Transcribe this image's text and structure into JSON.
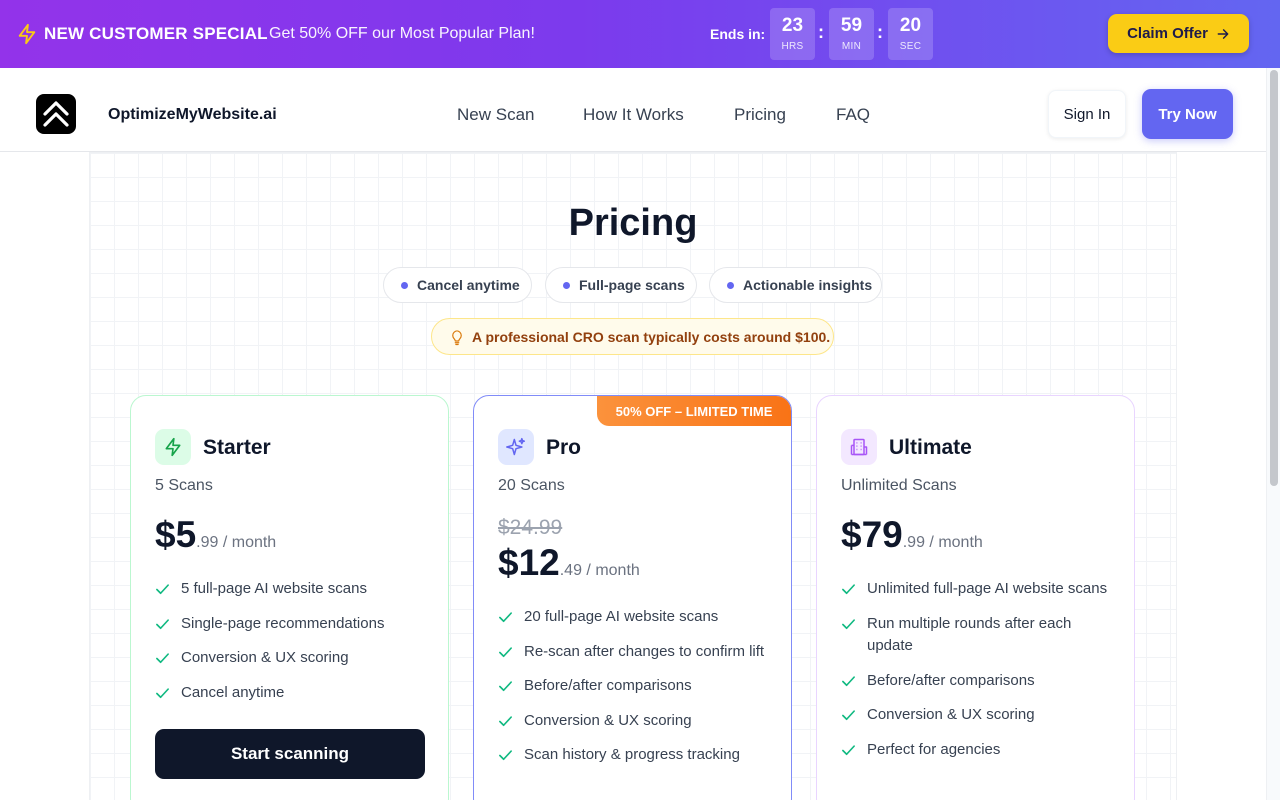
{
  "promo": {
    "headline": "NEW CUSTOMER SPECIAL",
    "subtext": "Get 50% OFF our Most Popular Plan!",
    "ends_label": "Ends in:",
    "countdown": [
      {
        "value": "23",
        "unit": "HRS"
      },
      {
        "value": "59",
        "unit": "MIN"
      },
      {
        "value": "20",
        "unit": "SEC"
      }
    ],
    "separator": ":",
    "claim_label": "Claim Offer",
    "icons": {
      "leading": "lightning-bolt-icon",
      "claim": "arrow-right-icon"
    }
  },
  "nav": {
    "brand": "OptimizeMyWebsite.ai",
    "logo_icon": "double-chevron-up-icon",
    "links": [
      "New Scan",
      "How It Works",
      "Pricing",
      "FAQ"
    ],
    "signin": "Sign In",
    "try_now": "Try Now"
  },
  "page": {
    "title": "Pricing",
    "pills": [
      "Cancel anytime",
      "Full-page scans",
      "Actionable insights"
    ],
    "note": "A professional CRO scan typically costs around $100.",
    "note_icon": "lightbulb-icon"
  },
  "plans": [
    {
      "name": "Starter",
      "icon": "lightning-icon",
      "scans": "5 Scans",
      "price_main": "$5",
      "price_rest": ".99 / month",
      "features": [
        "5 full-page AI website scans",
        "Single-page recommendations",
        "Conversion & UX scoring",
        "Cancel anytime"
      ],
      "cta": "Start scanning"
    },
    {
      "name": "Pro",
      "icon": "sparkles-icon",
      "badge": "50% OFF – LIMITED TIME",
      "scans": "20 Scans",
      "old_price": "$24.99",
      "price_main": "$12",
      "price_rest": ".49 / month",
      "features": [
        "20 full-page AI website scans",
        "Re-scan after changes to confirm lift",
        "Before/after comparisons",
        "Conversion & UX scoring",
        "Scan history & progress tracking"
      ]
    },
    {
      "name": "Ultimate",
      "icon": "building-icon",
      "scans": "Unlimited Scans",
      "price_main": "$79",
      "price_rest": ".99 / month",
      "features": [
        "Unlimited full-page AI website scans",
        "Run multiple rounds after each update",
        "Before/after comparisons",
        "Conversion & UX scoring",
        "Perfect for agencies"
      ]
    }
  ],
  "colors": {
    "accent": "#6366f1",
    "promo_gradient_start": "#9333ea",
    "claim_button": "#facc15",
    "check": "#10b981",
    "badge": "#f97316"
  }
}
